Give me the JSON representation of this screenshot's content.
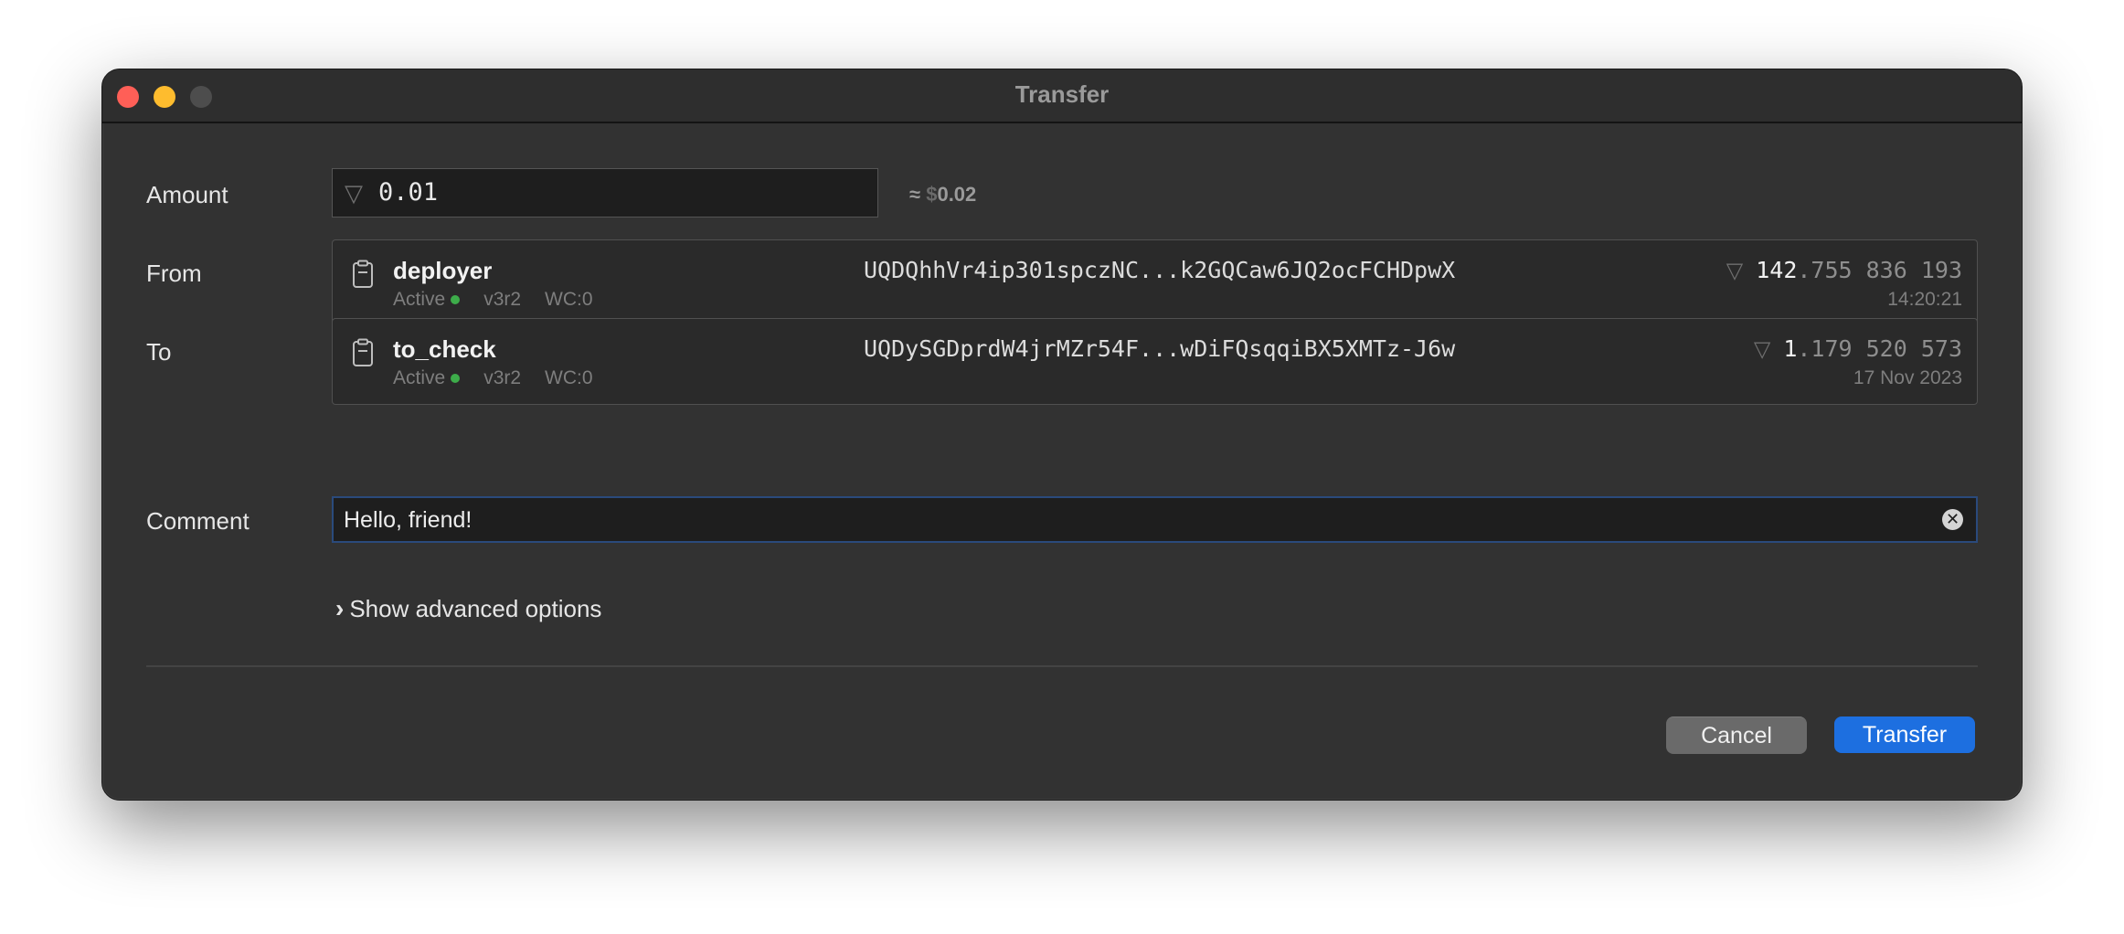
{
  "window": {
    "title": "Transfer"
  },
  "form": {
    "amount_label": "Amount",
    "from_label": "From",
    "to_label": "To",
    "comment_label": "Comment"
  },
  "amount": {
    "currency_icon": "ton-diamond-icon",
    "currency_glyph": "▽",
    "value": "0.01",
    "usd_prefix": "≈",
    "usd_symbol": "$",
    "usd_value": "0.02"
  },
  "from": {
    "name": "deployer",
    "status": "Active",
    "status_color": "#3dac4a",
    "version": "v3r2",
    "workchain": "WC:0",
    "address": "UQDQhhVr4ip301spczNC...k2GQCaw6JQ2ocFCHDpwX",
    "balance_int": "142",
    "balance_frac": ".755 836 193",
    "time": "14:20:21"
  },
  "to": {
    "name": "to_check",
    "status": "Active",
    "status_color": "#3dac4a",
    "version": "v3r2",
    "workchain": "WC:0",
    "address": "UQDySGDprdW4jrMZr54F...wDiFQsqqiBX5XMTz-J6w",
    "balance_int": "1",
    "balance_frac": ".179 520 573",
    "time": "17 Nov 2023"
  },
  "comment": {
    "value": "Hello, friend!",
    "clear_icon": "clear-circle-icon"
  },
  "advanced": {
    "label": "Show advanced options"
  },
  "buttons": {
    "cancel": "Cancel",
    "transfer": "Transfer"
  },
  "colors": {
    "accent": "#1d6fe0",
    "window_bg": "#323232",
    "close": "#ff5f57",
    "minimize": "#febc2e",
    "zoom_disabled": "#4d4d4d"
  }
}
